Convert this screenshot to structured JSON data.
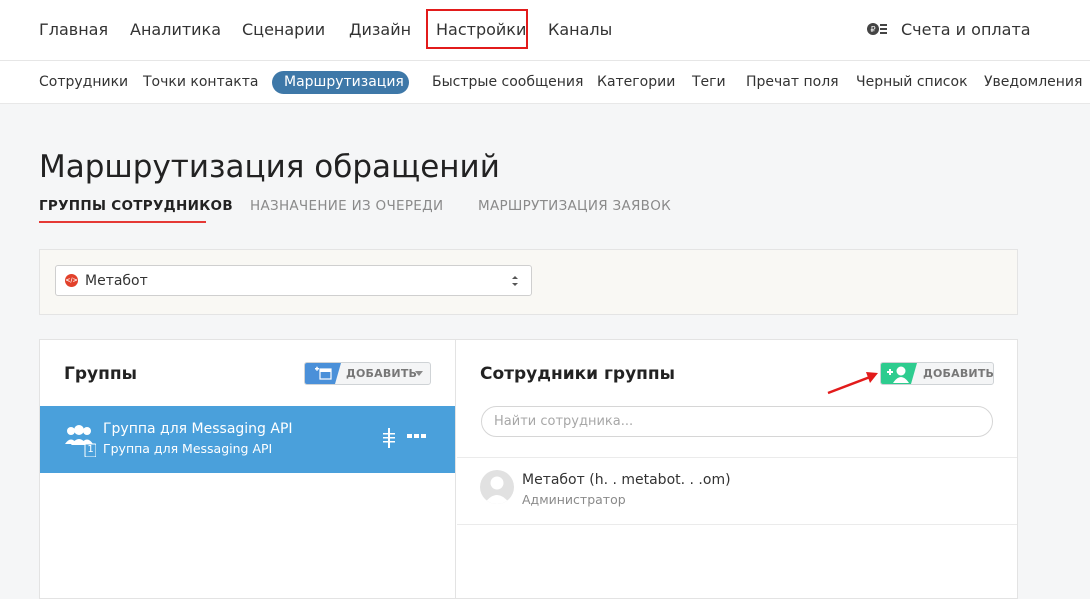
{
  "topnav": {
    "items": [
      "Главная",
      "Аналитика",
      "Сценарии",
      "Дизайн",
      "Настройки",
      "Каналы"
    ],
    "active": "Настройки",
    "billing_label": "Счета и оплата",
    "billing_icon": "coins-icon"
  },
  "subnav": {
    "items": [
      "Сотрудники",
      "Точки контакта",
      "Маршрутизация",
      "Быстрые сообщения",
      "Категории",
      "Теги",
      "Пречат поля",
      "Черный список",
      "Уведомления"
    ],
    "active": "Маршрутизация"
  },
  "page": {
    "title": "Маршрутизация обращений",
    "tabs": [
      "ГРУППЫ СОТРУДНИКОВ",
      "НАЗНАЧЕНИЕ ИЗ ОЧЕРЕДИ",
      "МАРШРУТИЗАЦИЯ ЗАЯВОК"
    ],
    "active_tab": "ГРУППЫ СОТРУДНИКОВ"
  },
  "bot_select": {
    "value": "Метабот",
    "icon": "code-bot-icon"
  },
  "groups_panel": {
    "title": "Группы",
    "add_label": "ДОБАВИТЬ",
    "groups": [
      {
        "name": "Группа для Messaging API",
        "subtitle": "Группа для Messaging API",
        "member_count": "1"
      }
    ]
  },
  "members_panel": {
    "title": "Сотрудники группы",
    "add_label": "ДОБАВИТЬ",
    "search_placeholder": "Найти сотрудника...",
    "members": [
      {
        "name": "Метабот (h. . metabot. . .om)",
        "role": "Администратор"
      }
    ]
  },
  "colors": {
    "accent_blue": "#4aa0db",
    "pill_blue": "#3e78a8",
    "add_green": "#2ecc8f",
    "highlight_red": "#e21b1b",
    "tab_underline": "#e53935"
  }
}
